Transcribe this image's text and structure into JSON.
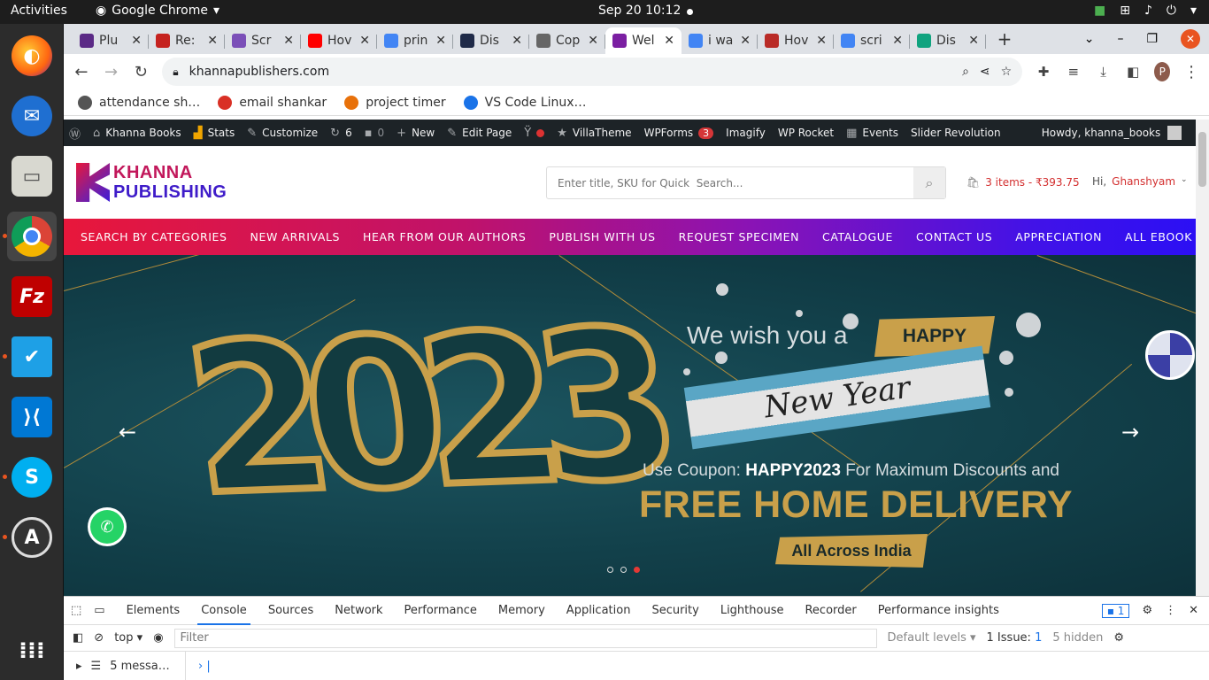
{
  "system": {
    "activities": "Activities",
    "app_name": "Google Chrome",
    "clock": "Sep 20  10:12"
  },
  "tabs": [
    {
      "title": "Plu",
      "color": "#5b2a86"
    },
    {
      "title": "Re:",
      "color": "#c5221f"
    },
    {
      "title": "Scr",
      "color": "#7b4fb8"
    },
    {
      "title": "Hov",
      "color": "#ff0000"
    },
    {
      "title": "prin",
      "color": "#4285f4"
    },
    {
      "title": "Dis",
      "color": "#1f2a48"
    },
    {
      "title": "Cop",
      "color": "#666666"
    },
    {
      "title": "Wel",
      "color": "#7b1fa2",
      "active": true
    },
    {
      "title": "i wa",
      "color": "#4285f4"
    },
    {
      "title": "Hov",
      "color": "#b92b27"
    },
    {
      "title": "scri",
      "color": "#4285f4"
    },
    {
      "title": "Dis",
      "color": "#10a37f"
    }
  ],
  "address_bar": {
    "url": "khannapublishers.com"
  },
  "bookmarks": [
    {
      "label": "attendance sh…",
      "color": "#555555"
    },
    {
      "label": "email shankar",
      "color": "#d93025"
    },
    {
      "label": "project timer",
      "color": "#e8710a"
    },
    {
      "label": "VS Code Linux…",
      "color": "#1a73e8"
    }
  ],
  "wp_admin_bar": {
    "site": "Khanna Books",
    "stats": "Stats",
    "customize": "Customize",
    "updates_count": "6",
    "comments_count": "0",
    "new": "New",
    "edit_page": "Edit Page",
    "villatheme": "VillaTheme",
    "wpforms": "WPForms",
    "wpforms_badge": "3",
    "imagify": "Imagify",
    "wp_rocket": "WP Rocket",
    "events": "Events",
    "slider_revolution": "Slider Revolution",
    "howdy": "Howdy, khanna_books"
  },
  "site": {
    "logo_line1": "KHANNA",
    "logo_line2": "PUBLISHING",
    "search_placeholder": "Enter title, SKU for Quick  Search...",
    "cart": "3 items - ₹393.75",
    "greeting": "Hi,",
    "user_name": "Ghanshyam"
  },
  "nav": [
    "SEARCH BY CATEGORIES",
    "NEW ARRIVALS",
    "HEAR FROM OUR AUTHORS",
    "PUBLISH WITH US",
    "REQUEST SPECIMEN",
    "CATALOGUE",
    "CONTACT US",
    "APPRECIATION",
    "ALL EBOOK"
  ],
  "banner": {
    "year": "2023",
    "wish": "We wish you a",
    "happy": "HAPPY",
    "new_year": "New Year",
    "coupon_prefix": "Use Coupon: ",
    "coupon_code": "HAPPY2023",
    "coupon_suffix": " For Maximum Discounts and",
    "headline": "FREE HOME DELIVERY",
    "tagline": "All Across India",
    "slides": 3,
    "active_slide": 3
  },
  "devtools": {
    "tabs": [
      "Elements",
      "Console",
      "Sources",
      "Network",
      "Performance",
      "Memory",
      "Application",
      "Security",
      "Lighthouse",
      "Recorder",
      "Performance insights"
    ],
    "active_tab": "Console",
    "issues_badge": "1",
    "context": "top",
    "filter_placeholder": "Filter",
    "levels": "Default levels",
    "issues_label": "1 Issue:",
    "issues_count": "1",
    "hidden": "5 hidden",
    "messages": "5 messa…"
  }
}
